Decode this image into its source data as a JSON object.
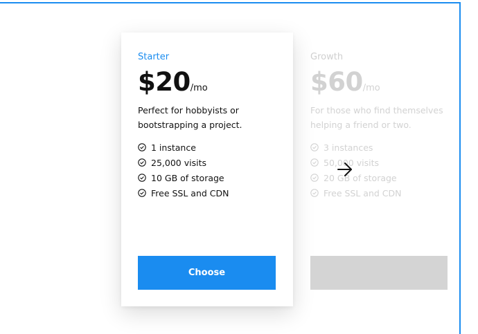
{
  "plans": [
    {
      "name": "Starter",
      "price": "$20",
      "unit": "/mo",
      "description": "Perfect for hobbyists or bootstrapping a project.",
      "features": [
        "1 instance",
        "25,000 visits",
        "10 GB of storage",
        "Free SSL and CDN"
      ],
      "button_label": "Choose"
    },
    {
      "name": "Growth",
      "price": "$60",
      "unit": "/mo",
      "description": "For those who find themselves helping a friend or two.",
      "features": [
        "3 instances",
        "50,000 visits",
        "20 GB of storage",
        "Free SSL and CDN"
      ],
      "button_label": ""
    }
  ],
  "icons": {
    "feature": "check-circle-icon",
    "carousel_next": "arrow-right-icon"
  },
  "colors": {
    "accent": "#1a8cf0",
    "text": "#111111",
    "muted": "#d2d2d2",
    "disabled_button": "#d4d4d4"
  }
}
